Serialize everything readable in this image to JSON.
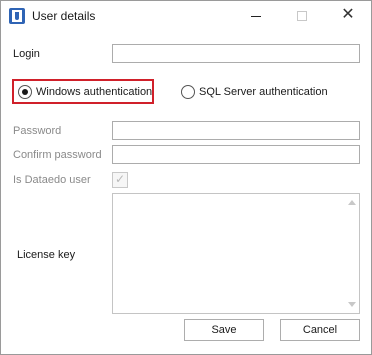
{
  "window": {
    "title": "User details",
    "icon": "app-icon",
    "controls": {
      "minimize_icon": "minimize-icon",
      "maximize_icon": "maximize-icon",
      "close_glyph": "✕"
    }
  },
  "form": {
    "login": {
      "label": "Login",
      "value": ""
    },
    "auth": {
      "options": [
        {
          "label": "Windows authentication",
          "selected": true
        },
        {
          "label": "SQL Server authentication",
          "selected": false
        }
      ],
      "highlight_color": "#d0202a"
    },
    "password": {
      "label": "Password",
      "value": "",
      "enabled": false
    },
    "confirm_password": {
      "label": "Confirm password",
      "value": "",
      "enabled": false
    },
    "is_dataedo_user": {
      "label": "Is Dataedo user",
      "checked": true,
      "enabled": false,
      "check_glyph": "✓"
    },
    "license_key": {
      "label": "License key",
      "value": ""
    }
  },
  "buttons": {
    "save": "Save",
    "cancel": "Cancel"
  }
}
